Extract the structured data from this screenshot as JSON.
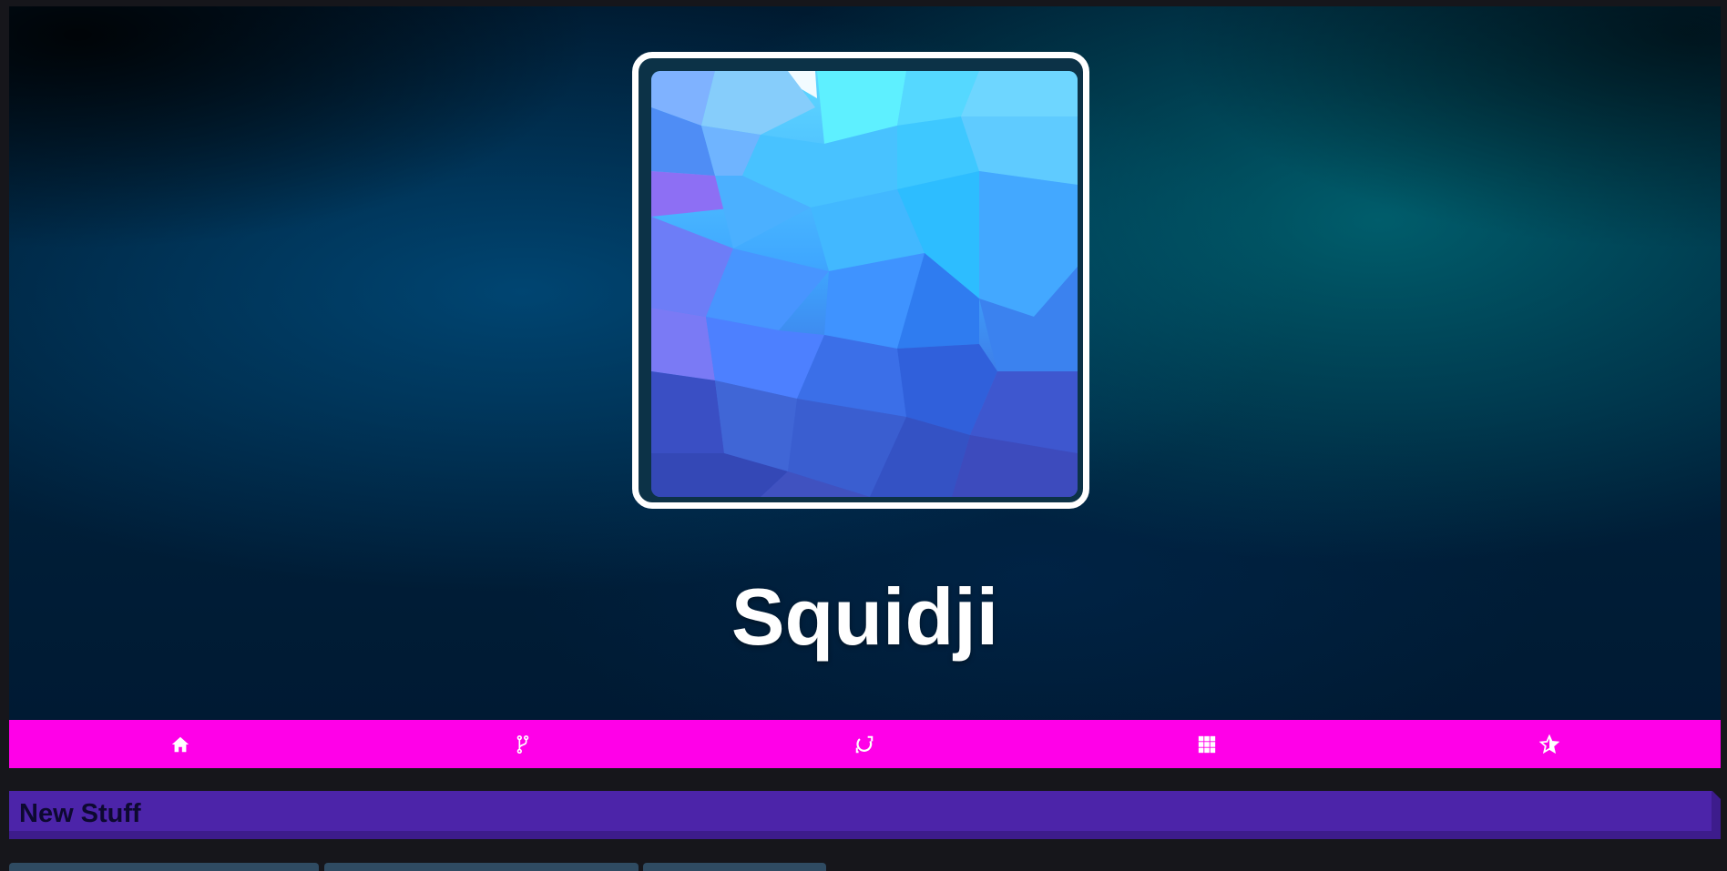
{
  "profile": {
    "name": "Squidji",
    "avatar_icon": "low-poly-blue-avatar"
  },
  "nav": {
    "items": [
      {
        "icon": "home-icon"
      },
      {
        "icon": "branch-icon"
      },
      {
        "icon": "sync-icon"
      },
      {
        "icon": "grid-icon"
      },
      {
        "icon": "star-icon"
      }
    ]
  },
  "section": {
    "title": "New Stuff"
  },
  "colors": {
    "nav_bg": "#ff00e8",
    "section_bg": "#4c24a9",
    "page_bg": "#16161b"
  }
}
